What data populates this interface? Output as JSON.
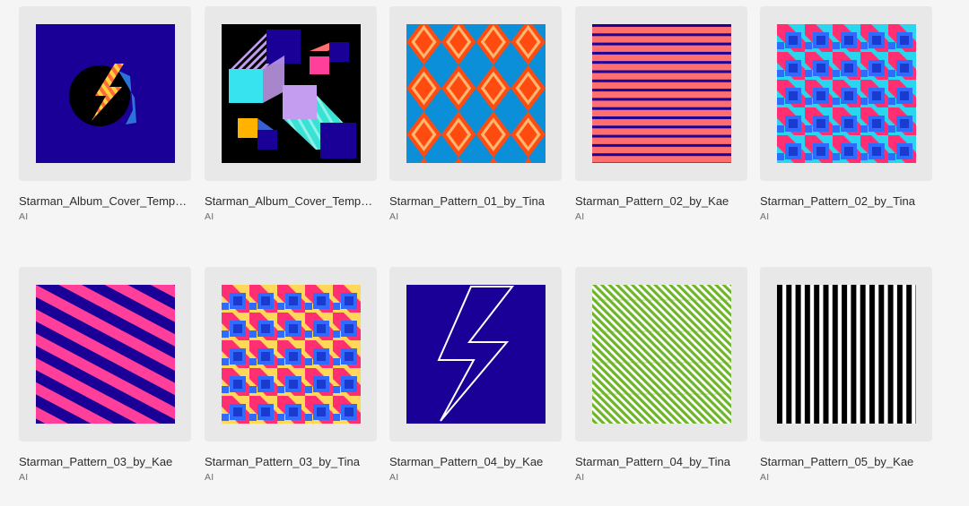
{
  "files": [
    {
      "name": "Starman_Album_Cover_Template_by_Kae",
      "type": "AI",
      "thumbnail": "album-cover-bolt-thumbnail"
    },
    {
      "name": "Starman_Album_Cover_Template_by_Tina",
      "type": "AI",
      "thumbnail": "album-cover-cubes-thumbnail"
    },
    {
      "name": "Starman_Pattern_01_by_Tina",
      "type": "AI",
      "thumbnail": "diamond-pattern-thumbnail"
    },
    {
      "name": "Starman_Pattern_02_by_Kae",
      "type": "AI",
      "thumbnail": "horizontal-stripe-pattern-thumbnail"
    },
    {
      "name": "Starman_Pattern_02_by_Tina",
      "type": "AI",
      "thumbnail": "cube-pattern-thumbnail"
    },
    {
      "name": "Starman_Pattern_03_by_Kae",
      "type": "AI",
      "thumbnail": "diagonal-stripe-pattern-thumbnail"
    },
    {
      "name": "Starman_Pattern_03_by_Tina",
      "type": "AI",
      "thumbnail": "cube-pattern-yellow-thumbnail"
    },
    {
      "name": "Starman_Pattern_04_by_Kae",
      "type": "AI",
      "thumbnail": "lightning-bolt-outline-thumbnail"
    },
    {
      "name": "Starman_Pattern_04_by_Tina",
      "type": "AI",
      "thumbnail": "green-diagonal-stripe-thumbnail"
    },
    {
      "name": "Starman_Pattern_05_by_Kae",
      "type": "AI",
      "thumbnail": "vertical-stripe-pattern-thumbnail"
    }
  ],
  "colors": {
    "navy": "#1a0096",
    "blue": "#0a8fd8",
    "orange": "#ff4a10",
    "coral": "#ff6f6f",
    "pink": "#ff3f9a",
    "magenta": "#ff2f72",
    "cyan": "#2ad6ee",
    "yellow": "#ffd85a",
    "lavender": "#c59df0",
    "aqua": "#38e3d6",
    "green": "#6fb52a",
    "black": "#000000"
  }
}
